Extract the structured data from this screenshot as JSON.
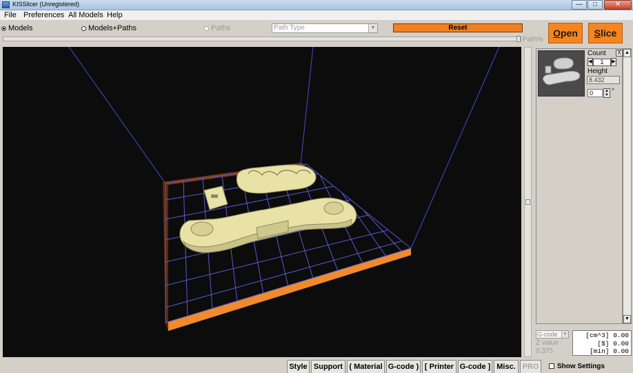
{
  "window": {
    "title": "KISSlicer (Unregistered)",
    "controls": [
      "minimize",
      "maximize",
      "close"
    ]
  },
  "menu": {
    "items": [
      "File",
      "Preferences",
      "All Models",
      "Help"
    ]
  },
  "toolbar": {
    "view_models": "Models",
    "view_models_paths": "Models+Paths",
    "view_paths": "Paths",
    "path_type_placeholder": "Path Type",
    "reset_label": "Reset",
    "path_pct_label": "Path%",
    "open_label": "pen",
    "open_mnemonic": "O",
    "slice_label": "lice",
    "slice_mnemonic": "S",
    "selected_view": "Models"
  },
  "model_panel": {
    "count_label": "Count",
    "count_value": "1",
    "height_label": "Height",
    "height_value": "8.432",
    "rotation_value": "0",
    "rotation_unit": "°",
    "close_label": "X"
  },
  "bottom": {
    "gcode_select": "G-code",
    "z_label": "Z value",
    "z_value": "0.375",
    "stats": [
      {
        "unit": "[cm^3]",
        "value": "0.00"
      },
      {
        "unit": "[$]",
        "value": "0.00"
      },
      {
        "unit": "[min]",
        "value": "0.00"
      }
    ],
    "tabs": [
      "Style",
      "Support",
      "( Material",
      "G-code )",
      "[ Printer",
      "G-code ]",
      "Misc.",
      "PRO"
    ],
    "show_settings": "Show Settings"
  },
  "colors": {
    "accent_orange": "#f5851f",
    "bed_edge": "#e87a1a",
    "grid": "#5a5ad6",
    "model": "#e8e2a6",
    "viewport_bg": "#0c0c0c"
  }
}
